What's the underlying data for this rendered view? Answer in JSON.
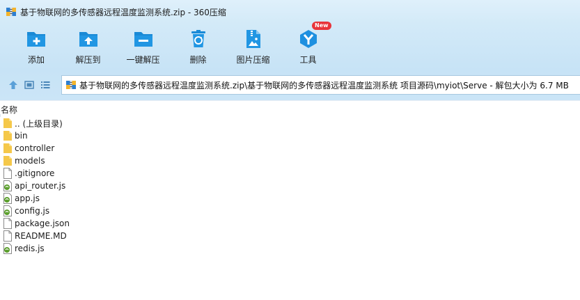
{
  "window": {
    "title": "基于物联网的多传感器远程温度监测系统.zip - 360压缩",
    "app_icon": "archive-icon"
  },
  "toolbar": {
    "buttons": [
      {
        "label": "添加",
        "icon": "add-icon"
      },
      {
        "label": "解压到",
        "icon": "extract-to-icon"
      },
      {
        "label": "一键解压",
        "icon": "one-click-extract-icon"
      },
      {
        "label": "删除",
        "icon": "delete-icon"
      },
      {
        "label": "图片压缩",
        "icon": "image-compress-icon"
      },
      {
        "label": "工具",
        "icon": "tools-icon",
        "badge": "New"
      }
    ]
  },
  "addressbar": {
    "path": "基于物联网的多传感器远程温度监测系统.zip\\基于物联网的多传感器远程温度监测系统 项目源码\\myiot\\Serve - 解包大小为 6.7 MB",
    "buttons": [
      "up-icon",
      "view-thumbnail-icon",
      "view-list-icon"
    ]
  },
  "filelist": {
    "column_name": "名称",
    "items": [
      {
        "name": ".. (上级目录)",
        "type": "folder"
      },
      {
        "name": "bin",
        "type": "folder"
      },
      {
        "name": "controller",
        "type": "folder"
      },
      {
        "name": "models",
        "type": "folder"
      },
      {
        "name": ".gitignore",
        "type": "file"
      },
      {
        "name": "api_router.js",
        "type": "js"
      },
      {
        "name": "app.js",
        "type": "js"
      },
      {
        "name": "config.js",
        "type": "js"
      },
      {
        "name": "package.json",
        "type": "file"
      },
      {
        "name": "README.MD",
        "type": "file"
      },
      {
        "name": "redis.js",
        "type": "js"
      }
    ]
  },
  "colors": {
    "toolbar_bg": "#c7e3f6",
    "icon_blue": "#1a8ad6",
    "badge_red": "#e8343a",
    "folder_yellow": "#f5c84a"
  }
}
